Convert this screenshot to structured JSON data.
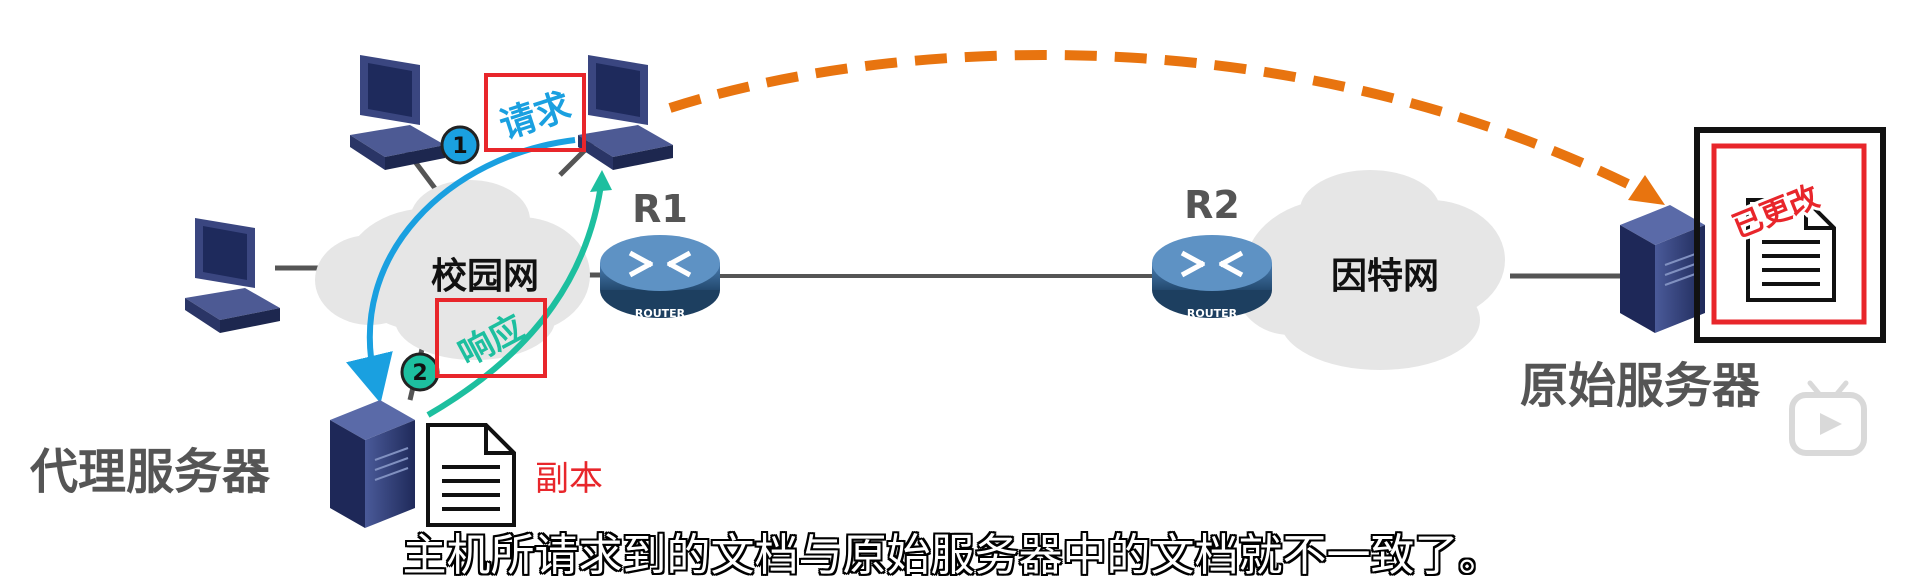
{
  "labels": {
    "request": "请求",
    "response": "响应",
    "step1": "1",
    "step2": "2",
    "r1": "R1",
    "r2": "R2",
    "router_text": "ROUTER",
    "campus_net": "校园网",
    "internet": "因特网",
    "proxy_server": "代理服务器",
    "origin_server": "原始服务器",
    "copy": "副本",
    "modified": "已更改"
  },
  "subtitle": "主机所请求到的文档与原始服务器中的文档就不一致了。",
  "colors": {
    "request_blue": "#1aa0e0",
    "response_teal": "#1dbf9f",
    "dashed_orange": "#e8740f",
    "highlight_red": "#e8262b",
    "cloud": "#e6e6e6",
    "router": "#2f5d8c",
    "server": "#2c3a72",
    "label_gray": "#555555"
  },
  "icons": {
    "hosts": "desktop-computer-icon",
    "router": "router-icon",
    "server": "server-tower-icon",
    "document": "document-icon",
    "watermark": "bilibili-tv-icon"
  }
}
